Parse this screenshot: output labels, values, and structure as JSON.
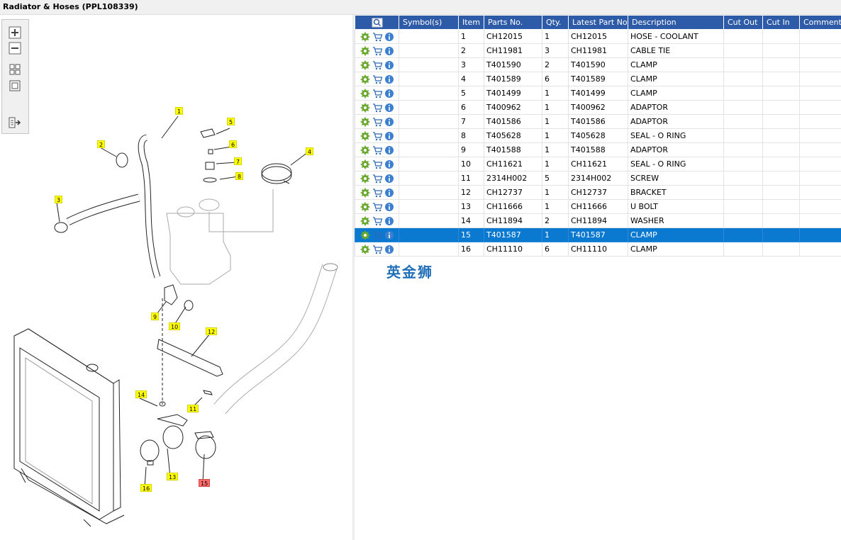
{
  "window": {
    "title": "Radiator & Hoses (PPL108339)"
  },
  "toolbar": {
    "tools": [
      {
        "name": "zoom-in-icon"
      },
      {
        "name": "zoom-out-icon"
      },
      {
        "name": "fit-all-icon"
      },
      {
        "name": "actual-size-icon"
      },
      {
        "name": "export-icon"
      }
    ]
  },
  "diagram": {
    "callouts": [
      "1",
      "2",
      "3",
      "4",
      "5",
      "6",
      "7",
      "8",
      "9",
      "10",
      "11",
      "12",
      "13",
      "14",
      "15",
      "16"
    ],
    "highlighted": "15"
  },
  "grid": {
    "columns": {
      "actions": "",
      "symbol": "Symbol(s)",
      "item": "Item",
      "parts_no": "Parts No.",
      "qty": "Qty.",
      "latest_part_no": "Latest Part No.",
      "description": "Description",
      "cut_out": "Cut Out",
      "cut_in": "Cut In",
      "comment": "Comment"
    },
    "rows": [
      {
        "item": "1",
        "parts_no": "CH12015",
        "qty": "1",
        "latest": "CH12015",
        "desc": "HOSE - COOLANT"
      },
      {
        "item": "2",
        "parts_no": "CH11981",
        "qty": "3",
        "latest": "CH11981",
        "desc": "CABLE TIE"
      },
      {
        "item": "3",
        "parts_no": "T401590",
        "qty": "2",
        "latest": "T401590",
        "desc": "CLAMP"
      },
      {
        "item": "4",
        "parts_no": "T401589",
        "qty": "6",
        "latest": "T401589",
        "desc": "CLAMP"
      },
      {
        "item": "5",
        "parts_no": "T401499",
        "qty": "1",
        "latest": "T401499",
        "desc": "CLAMP"
      },
      {
        "item": "6",
        "parts_no": "T400962",
        "qty": "1",
        "latest": "T400962",
        "desc": "ADAPTOR"
      },
      {
        "item": "7",
        "parts_no": "T401586",
        "qty": "1",
        "latest": "T401586",
        "desc": "ADAPTOR"
      },
      {
        "item": "8",
        "parts_no": "T405628",
        "qty": "1",
        "latest": "T405628",
        "desc": "SEAL - O RING"
      },
      {
        "item": "9",
        "parts_no": "T401588",
        "qty": "1",
        "latest": "T401588",
        "desc": "ADAPTOR"
      },
      {
        "item": "10",
        "parts_no": "CH11621",
        "qty": "1",
        "latest": "CH11621",
        "desc": "SEAL - O RING"
      },
      {
        "item": "11",
        "parts_no": "2314H002",
        "qty": "5",
        "latest": "2314H002",
        "desc": "SCREW"
      },
      {
        "item": "12",
        "parts_no": "CH12737",
        "qty": "1",
        "latest": "CH12737",
        "desc": "BRACKET"
      },
      {
        "item": "13",
        "parts_no": "CH11666",
        "qty": "1",
        "latest": "CH11666",
        "desc": "U BOLT"
      },
      {
        "item": "14",
        "parts_no": "CH11894",
        "qty": "2",
        "latest": "CH11894",
        "desc": "WASHER"
      },
      {
        "item": "15",
        "parts_no": "T401587",
        "qty": "1",
        "latest": "T401587",
        "desc": "CLAMP"
      },
      {
        "item": "16",
        "parts_no": "CH11110",
        "qty": "6",
        "latest": "CH11110",
        "desc": "CLAMP"
      }
    ],
    "selected_item": "15"
  },
  "watermark": {
    "text": "英金狮"
  },
  "colors": {
    "header_bg": "#2e5ba8",
    "selection_bg": "#0b79d0",
    "callout_bg": "#ffff00",
    "callout_highlight": "#ff6a6a"
  }
}
